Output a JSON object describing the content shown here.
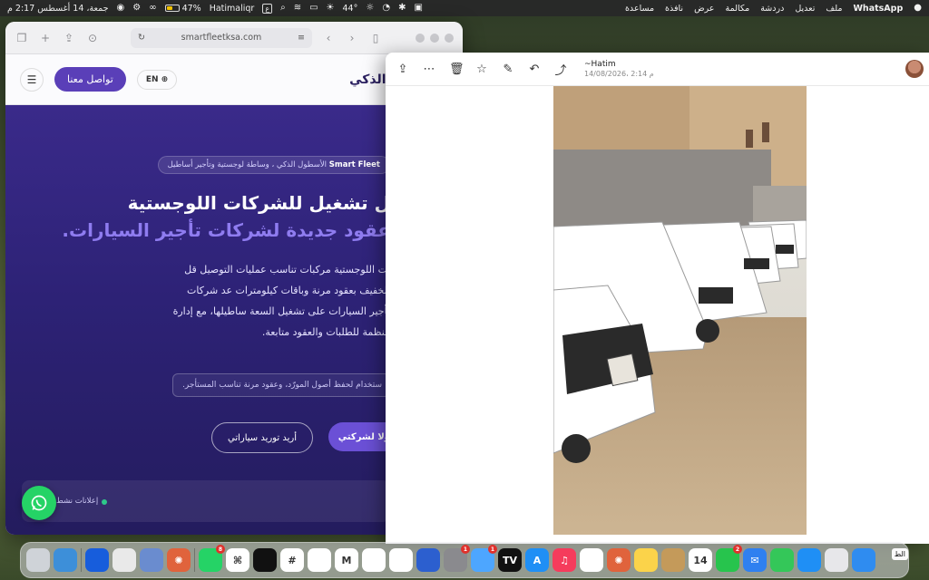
{
  "menubar": {
    "apple": "",
    "app_name": "WhatsApp",
    "menus": [
      "ملف",
      "تعديل",
      "دردشة",
      "مكالمة",
      "عرض",
      "نافذة",
      "مساعدة"
    ],
    "status": {
      "temperature": "44°",
      "keyboard_badge": "ع",
      "user": "Hatimaliqr",
      "battery_percent": "47%",
      "battery_level": 0.47,
      "datetime": "جمعة، 14 أغسطس  2:17 م"
    }
  },
  "safari": {
    "url": "smartfleetksa.com",
    "site": {
      "brand": "الأسطول الذكي",
      "contact_button": "تواصل معنا",
      "language_button": "EN",
      "breadcrumb_brand": "Smart Fleet",
      "breadcrumb_rest": "الأسطول الذكي ، وساطة لوجستية وتأجير أساطيل",
      "hero_title_line1": "ل تشغيل للشركات اللوجستية",
      "hero_title_line2": "عقود جديدة لشركات تأجير السيارات.",
      "hero_paragraph": "ات اللوجستية مركبات تناسب عمليات التوصيل قل الخفيف بعقود مرنة وباقات كيلومترات عد شركات تأجير السيارات على تشغيل السعة ساطيلها، مع إدارة منظمة للطلبات والعقود متابعة.",
      "hero_input_text": "ستخدام لحفظ أصول المورّد، وعقود مرنة تناسب المستأجر.",
      "primary_button": "ولا لشركتي",
      "secondary_button": "أريد توريد سياراتي",
      "notice_text": "إعلانات نشط",
      "notice_right": "ة"
    }
  },
  "viewer": {
    "sender_name": "~Hatim",
    "date": "14/08/2026، 2:14 م"
  },
  "dock": {
    "apps": [
      {
        "name": "trash",
        "label": "",
        "color": "#cfd3d8"
      },
      {
        "name": "folder",
        "label": "",
        "color": "#3d8fd9"
      },
      {
        "name": "bitwarden",
        "label": "",
        "color": "#175ddc"
      },
      {
        "name": "textedit",
        "label": "",
        "color": "#e9e9e9"
      },
      {
        "name": "preview",
        "label": "",
        "color": "#6a8ccf"
      },
      {
        "name": "claude",
        "label": "✺",
        "color": "#e0633c"
      },
      {
        "name": "whatsapp",
        "label": "",
        "color": "#25d366",
        "badge": "8"
      },
      {
        "name": "chatgpt",
        "label": "⌘",
        "color": "#ffffff"
      },
      {
        "name": "perplexity",
        "label": "",
        "color": "#111111"
      },
      {
        "name": "slack",
        "label": "#",
        "color": "#ffffff"
      },
      {
        "name": "github",
        "label": "",
        "color": "#ffffff"
      },
      {
        "name": "gmail",
        "label": "M",
        "color": "#ffffff"
      },
      {
        "name": "chrome",
        "label": "",
        "color": "#ffffff"
      },
      {
        "name": "openai",
        "label": "",
        "color": "#ffffff"
      },
      {
        "name": "notes-dark",
        "label": "",
        "color": "#2c5fcf"
      },
      {
        "name": "settings",
        "label": "",
        "color": "#8a8a8e",
        "badge": "1"
      },
      {
        "name": "cleaner",
        "label": "",
        "color": "#4da6ff",
        "badge": "1"
      },
      {
        "name": "tradingview",
        "label": "TV",
        "color": "#111111"
      },
      {
        "name": "appstore",
        "label": "A",
        "color": "#1f8ff5"
      },
      {
        "name": "music",
        "label": "♫",
        "color": "#f53c5c"
      },
      {
        "name": "freeform",
        "label": "",
        "color": "#ffffff"
      },
      {
        "name": "claude2",
        "label": "✺",
        "color": "#e0633c"
      },
      {
        "name": "notes",
        "label": "",
        "color": "#fbd34a"
      },
      {
        "name": "archive",
        "label": "",
        "color": "#c49a5a"
      },
      {
        "name": "calendar",
        "label": "14",
        "color": "#ffffff"
      },
      {
        "name": "facetime",
        "label": "",
        "color": "#27c44d",
        "badge": "2"
      },
      {
        "name": "mail",
        "label": "✉",
        "color": "#2f80f0"
      },
      {
        "name": "messages",
        "label": "",
        "color": "#34c759"
      },
      {
        "name": "safari",
        "label": "",
        "color": "#1f8ff5"
      },
      {
        "name": "launchpad",
        "label": "",
        "color": "#e7e7ea"
      },
      {
        "name": "finder",
        "label": "",
        "color": "#2f8cf0"
      }
    ],
    "tail_label": "الط"
  }
}
